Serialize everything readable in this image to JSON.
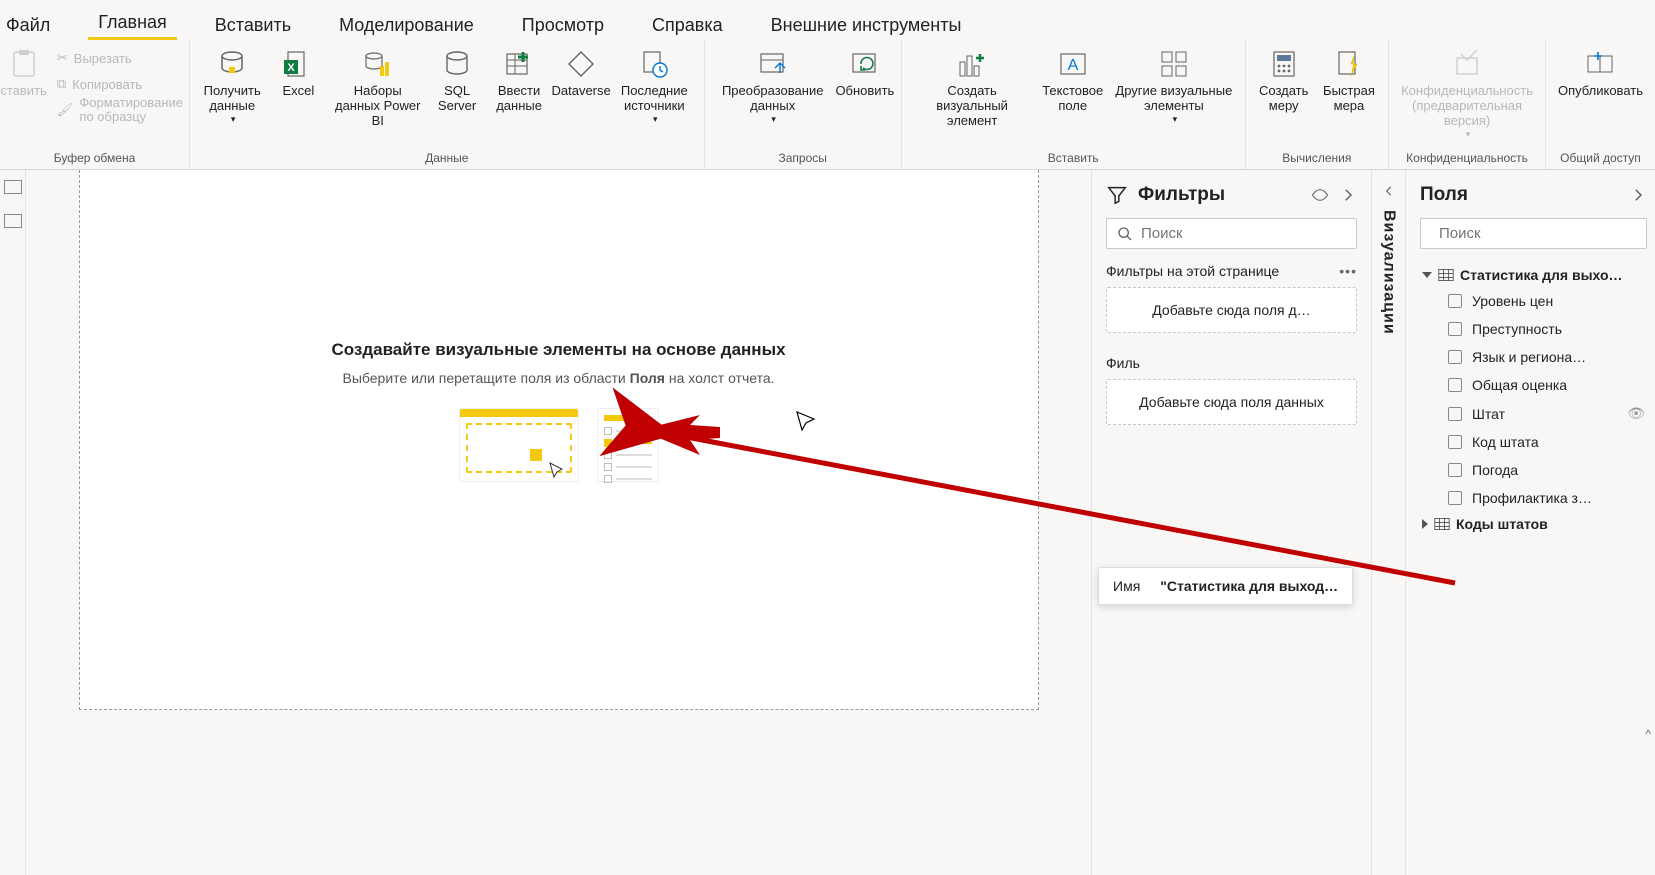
{
  "tabs": [
    "Файл",
    "Главная",
    "Вставить",
    "Моделирование",
    "Просмотр",
    "Справка",
    "Внешние инструменты"
  ],
  "active_tab_index": 1,
  "ribbon": {
    "paste": "ставить",
    "clipboard": {
      "cut": "Вырезать",
      "copy": "Копировать",
      "format": "Форматирование по образцу",
      "group": "Буфер обмена"
    },
    "data": {
      "get_data": "Получить данные",
      "excel": "Excel",
      "pbi_datasets": "Наборы данных Power BI",
      "sql": "SQL Server",
      "enter_data": "Ввести данные",
      "dataverse": "Dataverse",
      "recent": "Последние источники",
      "group": "Данные"
    },
    "queries": {
      "transform": "Преобразование данных",
      "refresh": "Обновить",
      "group": "Запросы"
    },
    "insert": {
      "visual": "Создать визуальный элемент",
      "text": "Текстовое поле",
      "more": "Другие визуальные элементы",
      "group": "Вставить"
    },
    "calc": {
      "measure": "Создать меру",
      "quick": "Быстрая мера",
      "group": "Вычисления"
    },
    "sens": {
      "label": "Конфиденциальность (предварительная версия)",
      "group": "Конфиденциальность"
    },
    "share": {
      "publish": "Опубликовать",
      "group": "Общий доступ"
    }
  },
  "canvas": {
    "title": "Создавайте визуальные элементы на основе данных",
    "subtitle_a": "Выберите или перетащите поля из области ",
    "subtitle_b": "Поля",
    "subtitle_c": " на холст отчета."
  },
  "filters": {
    "title": "Фильтры",
    "search_ph": "Поиск",
    "page_filters": "Фильтры на этой странице",
    "drop1": "Добавьте сюда поля д…",
    "allpages_prefix": "Филь",
    "drop2": "Добавьте сюда поля данных"
  },
  "viz": {
    "label": "Визуализации"
  },
  "fields": {
    "title": "Поля",
    "search_ph": "Поиск",
    "table1": "Статистика для выхо…",
    "table1_fields": [
      "Уровень цен",
      "Преступность",
      "Язык и региона…",
      "Общая оценка",
      "Штат",
      "Код штата",
      "Погода",
      "Профилактика з…"
    ],
    "table2": "Коды штатов"
  },
  "tooltip": {
    "key": "Имя",
    "value": "\"Статистика для выход…"
  }
}
